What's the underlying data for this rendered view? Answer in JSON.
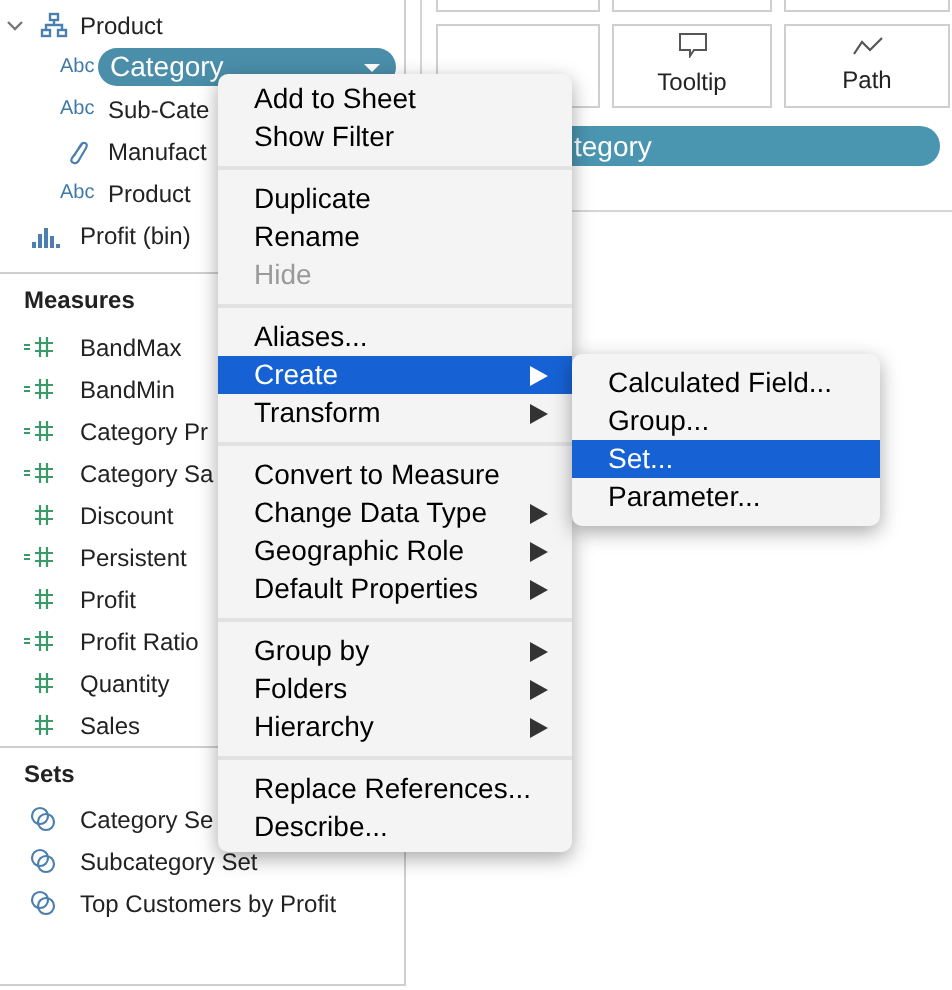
{
  "dimensions": {
    "items": [
      {
        "label": "Product",
        "kind": "hierarchy",
        "expanded": true,
        "children": [
          {
            "label": "Category",
            "kind": "string",
            "type_label": "Abc",
            "selected": true
          },
          {
            "label": "Sub-Cate",
            "kind": "string",
            "type_label": "Abc",
            "selected": false
          },
          {
            "label": "Manufact",
            "kind": "group",
            "selected": false
          },
          {
            "label": "Product",
            "kind": "string",
            "type_label": "Abc",
            "selected": false
          }
        ]
      },
      {
        "label": "Profit (bin)",
        "kind": "bin"
      }
    ]
  },
  "measures": {
    "title": "Measures",
    "items": [
      {
        "label": "BandMax",
        "kind": "calculated"
      },
      {
        "label": "BandMin",
        "kind": "calculated"
      },
      {
        "label": "Category Pr",
        "kind": "calculated"
      },
      {
        "label": "Category Sa",
        "kind": "calculated"
      },
      {
        "label": "Discount",
        "kind": "number"
      },
      {
        "label": "Persistent",
        "kind": "calculated"
      },
      {
        "label": "Profit",
        "kind": "number"
      },
      {
        "label": "Profit Ratio",
        "kind": "calculated"
      },
      {
        "label": "Quantity",
        "kind": "number"
      },
      {
        "label": "Sales",
        "kind": "number"
      }
    ]
  },
  "sets": {
    "title": "Sets",
    "items": [
      {
        "label": "Category Se"
      },
      {
        "label": "Subcategory Set"
      },
      {
        "label": "Top Customers by Profit"
      }
    ]
  },
  "marks": {
    "cards": [
      {
        "label": "Tooltip",
        "kind": "tooltip"
      },
      {
        "label": "Path",
        "kind": "path"
      }
    ],
    "pill": "tegory"
  },
  "context_menu": {
    "groups": [
      [
        {
          "label": "Add to Sheet",
          "submenu": false,
          "disabled": false,
          "selected": false
        },
        {
          "label": "Show Filter",
          "submenu": false,
          "disabled": false,
          "selected": false
        }
      ],
      [
        {
          "label": "Duplicate",
          "submenu": false,
          "disabled": false,
          "selected": false
        },
        {
          "label": "Rename",
          "submenu": false,
          "disabled": false,
          "selected": false
        },
        {
          "label": "Hide",
          "submenu": false,
          "disabled": true,
          "selected": false
        }
      ],
      [
        {
          "label": "Aliases...",
          "submenu": false,
          "disabled": false,
          "selected": false
        },
        {
          "label": "Create",
          "submenu": true,
          "disabled": false,
          "selected": true
        },
        {
          "label": "Transform",
          "submenu": true,
          "disabled": false,
          "selected": false
        }
      ],
      [
        {
          "label": "Convert to Measure",
          "submenu": false,
          "disabled": false,
          "selected": false
        },
        {
          "label": "Change Data Type",
          "submenu": true,
          "disabled": false,
          "selected": false
        },
        {
          "label": "Geographic Role",
          "submenu": true,
          "disabled": false,
          "selected": false
        },
        {
          "label": "Default Properties",
          "submenu": true,
          "disabled": false,
          "selected": false
        }
      ],
      [
        {
          "label": "Group by",
          "submenu": true,
          "disabled": false,
          "selected": false
        },
        {
          "label": "Folders",
          "submenu": true,
          "disabled": false,
          "selected": false
        },
        {
          "label": "Hierarchy",
          "submenu": true,
          "disabled": false,
          "selected": false
        }
      ],
      [
        {
          "label": "Replace References...",
          "submenu": false,
          "disabled": false,
          "selected": false
        },
        {
          "label": "Describe...",
          "submenu": false,
          "disabled": false,
          "selected": false
        }
      ]
    ]
  },
  "submenu": {
    "items": [
      {
        "label": "Calculated Field...",
        "selected": false
      },
      {
        "label": "Group...",
        "selected": false
      },
      {
        "label": "Set...",
        "selected": true
      },
      {
        "label": "Parameter...",
        "selected": false
      }
    ]
  }
}
